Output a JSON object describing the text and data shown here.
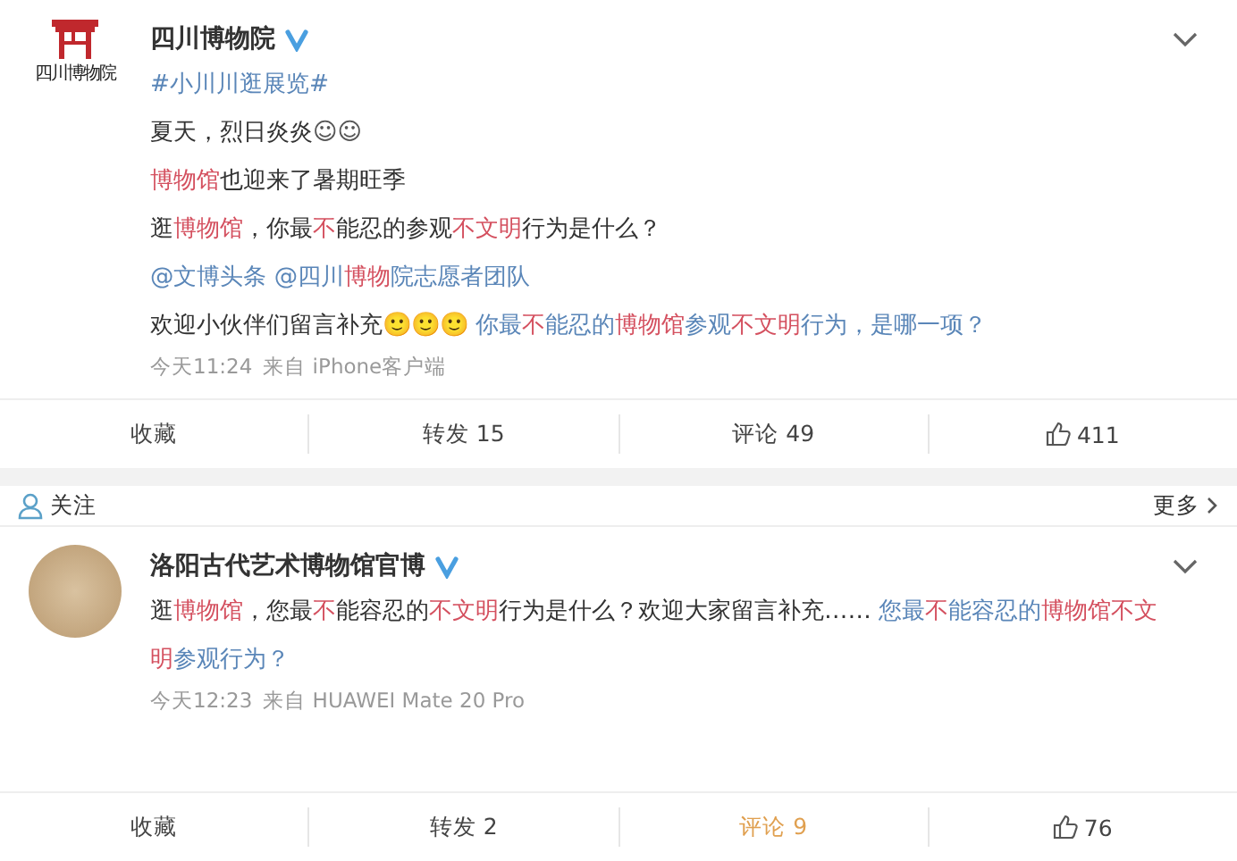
{
  "posts": [
    {
      "author": "四川博物院",
      "verified": true,
      "avatar": {
        "kind": "logo",
        "text": "四川博物院"
      },
      "paragraphs": [
        [
          {
            "kind": "link",
            "text": "#小川川逛展览#"
          }
        ],
        [
          {
            "kind": "plain",
            "text": "夏天，烈日炎炎"
          },
          {
            "kind": "emoji-small",
            "text": "☺☺"
          }
        ],
        [
          {
            "kind": "highlight",
            "text": "博物馆"
          },
          {
            "kind": "plain",
            "text": "也迎来了暑期旺季"
          }
        ],
        [
          {
            "kind": "plain",
            "text": "逛"
          },
          {
            "kind": "highlight",
            "text": "博物馆"
          },
          {
            "kind": "plain",
            "text": "，你最"
          },
          {
            "kind": "highlight",
            "text": "不"
          },
          {
            "kind": "plain",
            "text": "能忍的参观"
          },
          {
            "kind": "highlight",
            "text": "不文明"
          },
          {
            "kind": "plain",
            "text": "行为是什么？"
          }
        ],
        [
          {
            "kind": "link",
            "text": "@文博头条 @四川"
          },
          {
            "kind": "highlight",
            "text": "博物"
          },
          {
            "kind": "link",
            "text": "院志愿者团队"
          }
        ],
        [
          {
            "kind": "plain",
            "text": "欢迎小伙伴们留言补充"
          },
          {
            "kind": "emoji",
            "text": "🙂🙂🙂"
          },
          {
            "kind": "link",
            "text": " 你最"
          },
          {
            "kind": "highlight",
            "text": "不"
          },
          {
            "kind": "link",
            "text": "能忍的"
          },
          {
            "kind": "highlight",
            "text": "博物馆"
          },
          {
            "kind": "link",
            "text": "参观"
          },
          {
            "kind": "highlight",
            "text": "不文明"
          },
          {
            "kind": "link",
            "text": "行为，是哪一项？"
          }
        ]
      ],
      "time": "今天11:24",
      "source": "来自 iPhone客户端",
      "actions": [
        {
          "kind": "text",
          "label": "收藏",
          "selected": false
        },
        {
          "kind": "text",
          "label": "转发 15",
          "selected": false
        },
        {
          "kind": "text",
          "label": "评论 49",
          "selected": false
        },
        {
          "kind": "like",
          "label": "411",
          "selected": false
        }
      ]
    },
    {
      "author": "洛阳古代艺术博物馆官博",
      "verified": true,
      "avatar": {
        "kind": "photo"
      },
      "header_bar": {
        "follow": "关注",
        "more": "更多"
      },
      "paragraphs": [
        [
          {
            "kind": "plain",
            "text": "逛"
          },
          {
            "kind": "highlight",
            "text": "博物馆"
          },
          {
            "kind": "plain",
            "text": "，您最"
          },
          {
            "kind": "highlight",
            "text": "不"
          },
          {
            "kind": "plain",
            "text": "能容忍的"
          },
          {
            "kind": "highlight",
            "text": "不文明"
          },
          {
            "kind": "plain",
            "text": "行为是什么？欢迎大家留言补充……"
          },
          {
            "kind": "link",
            "text": " 您最"
          },
          {
            "kind": "highlight",
            "text": "不"
          },
          {
            "kind": "link",
            "text": "能容忍的"
          },
          {
            "kind": "highlight",
            "text": "博物馆"
          },
          {
            "kind": "highlight",
            "text": "不文明"
          },
          {
            "kind": "link",
            "text": "参观行为？"
          }
        ]
      ],
      "time": "今天12:23",
      "source": "来自 HUAWEI Mate 20 Pro",
      "actions": [
        {
          "kind": "text",
          "label": "收藏",
          "selected": false
        },
        {
          "kind": "text",
          "label": "转发 2",
          "selected": false
        },
        {
          "kind": "text",
          "label": "评论 9",
          "selected": true
        },
        {
          "kind": "like",
          "label": "76",
          "selected": false
        }
      ]
    }
  ]
}
